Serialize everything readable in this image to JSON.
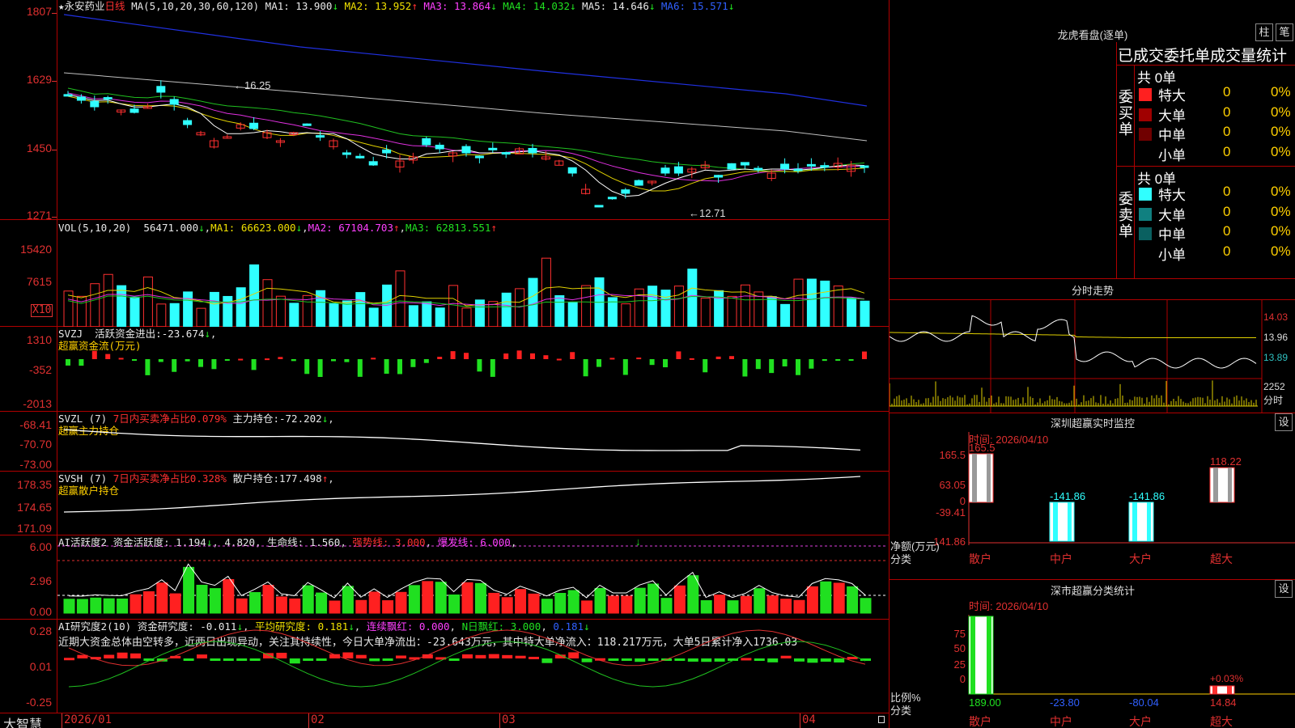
{
  "stock": {
    "star": "★",
    "name": "永安药业",
    "period": "日线"
  },
  "price_pane": {
    "ma_title": "MA(5,10,20,30,60,120)",
    "ma": [
      {
        "label": "MA1:",
        "value": "13.900",
        "arrow": "↓",
        "color": "#e8e8e8"
      },
      {
        "label": "MA2:",
        "value": "13.952",
        "arrow": "↑",
        "color": "#f0e000"
      },
      {
        "label": "MA3:",
        "value": "13.864",
        "arrow": "↓",
        "color": "#ff40ff"
      },
      {
        "label": "MA4:",
        "value": "14.032",
        "arrow": "↓",
        "color": "#20e020"
      },
      {
        "label": "MA5:",
        "value": "14.646",
        "arrow": "↓",
        "color": "#e8e8e8"
      },
      {
        "label": "MA6:",
        "value": "15.571",
        "arrow": "↓",
        "color": "#3060ff"
      }
    ],
    "y_labels": [
      "1807",
      "1629",
      "1450",
      "1271"
    ],
    "high_marker": "16.25",
    "low_marker": "12.71"
  },
  "vol_pane": {
    "title": "VOL(5,10,20)",
    "value": "56471.000",
    "arrow": "↓",
    "ma1": "66623.000",
    "ma1_arrow": "↓",
    "ma2": "67104.703",
    "ma2_arrow": "↑",
    "ma3": "62813.551",
    "ma3_arrow": "↑",
    "y_labels": [
      "15420",
      "7615"
    ],
    "unit": "X10"
  },
  "svzj_pane": {
    "title": "SVZJ",
    "label": "活跃资金进出:",
    "value": "-23.674",
    "arrow": "↓",
    "sub": "超赢资金流(万元)",
    "y_labels": [
      "1310",
      "-352",
      "-2013"
    ]
  },
  "svzl_pane": {
    "title": "SVZL (7)",
    "ratio": "7日内买卖净占比0.079%",
    "label": "主力持仓:",
    "value": "-72.202",
    "arrow": "↓",
    "sub": "超赢主力持仓",
    "y_labels": [
      "-68.41",
      "-70.70",
      "-73.00"
    ]
  },
  "svsh_pane": {
    "title": "SVSH (7)",
    "ratio": "7日内买卖净占比0.328%",
    "label": "散户持仓:",
    "value": "177.498",
    "arrow": "↑",
    "sub": "超赢散户持仓",
    "y_labels": [
      "178.35",
      "174.65",
      "171.09"
    ]
  },
  "ai1_pane": {
    "title": "AI活跃度2",
    "label": "资金活跃度:",
    "value": "1.194",
    "arrow": "↓",
    "v2": "4.820",
    "label3": "生命线:",
    "v3": "1.560",
    "label4": "强势线:",
    "v4": "3.000",
    "label5": "爆发线:",
    "v5": "6.000",
    "y_labels": [
      "6.00",
      "2.96",
      "0.00"
    ]
  },
  "ai2_pane": {
    "title": "AI研究度2(10)",
    "label": "资金研究度:",
    "value": "-0.011",
    "arrow": "↓",
    "label2": "平均研究度:",
    "v2": "0.181",
    "arrow2": "↓",
    "label3": "连续飘红:",
    "v3": "0.000",
    "label4": "N日飘红:",
    "v4": "3.000",
    "v5": "0.181",
    "arrow5": "↓",
    "note": "近期大资金总体由空转多，近两日出现异动，关注其持续性，今日大单净流出：-23.643万元，其中特大单净流入：118.217万元，大单5日累计净入1736.03",
    "y_labels": [
      "0.28",
      "0.01",
      "-0.25"
    ]
  },
  "x_axis": [
    "2026/01",
    "02",
    "03",
    "04"
  ],
  "brand": "大智慧",
  "right": {
    "longhu_title": "龙虎看盘(逐单)",
    "btn1": "柱",
    "btn2": "笔",
    "stat_title": "已成交委托单成交量统计",
    "buy": {
      "side": "委买单",
      "total": "共 0单",
      "rows": [
        {
          "name": "特大",
          "count": "0",
          "pct": "0%",
          "color": "#ff2020"
        },
        {
          "name": "大单",
          "count": "0",
          "pct": "0%",
          "color": "#a00000"
        },
        {
          "name": "中单",
          "count": "0",
          "pct": "0%",
          "color": "#700000"
        },
        {
          "name": "小单",
          "count": "0",
          "pct": "0%",
          "color": "#000000"
        }
      ]
    },
    "sell": {
      "side": "委卖单",
      "total": "共 0单",
      "rows": [
        {
          "name": "特大",
          "count": "0",
          "pct": "0%",
          "color": "#30ffff"
        },
        {
          "name": "大单",
          "count": "0",
          "pct": "0%",
          "color": "#108080"
        },
        {
          "name": "中单",
          "count": "0",
          "pct": "0%",
          "color": "#0a6060"
        },
        {
          "name": "小单",
          "count": "0",
          "pct": "0%",
          "color": "#000000"
        }
      ]
    },
    "intraday_title": "分时走势",
    "intraday_labels": [
      "14.03",
      "13.96",
      "13.89",
      "2252",
      "分时"
    ],
    "sz_title": "深圳超赢实时监控",
    "set": "设",
    "time_label": "时间: 2026/04/10",
    "sz_y": [
      "165.5",
      "63.05",
      "0",
      "-39.41",
      "-141.86"
    ],
    "sz_unit": "净额(万元)",
    "cls": "分类",
    "sz_values": [
      {
        "name": "散户",
        "value": "165.5"
      },
      {
        "name": "中户",
        "value": "-141.86"
      },
      {
        "name": "大户",
        "value": "-141.86"
      },
      {
        "name": "超大",
        "value": "118.22"
      }
    ],
    "szfl_title": "深市超赢分类统计",
    "fl_y": [
      "75",
      "50",
      "25",
      "0"
    ],
    "fl_unit": "比例%",
    "fl_values": [
      {
        "name": "散户",
        "value": "189.00"
      },
      {
        "name": "中户",
        "value": "-23.80"
      },
      {
        "name": "大户",
        "value": "-80.04"
      },
      {
        "name": "超大",
        "value": "14.84"
      }
    ],
    "fl_top": "+0.03%"
  }
}
